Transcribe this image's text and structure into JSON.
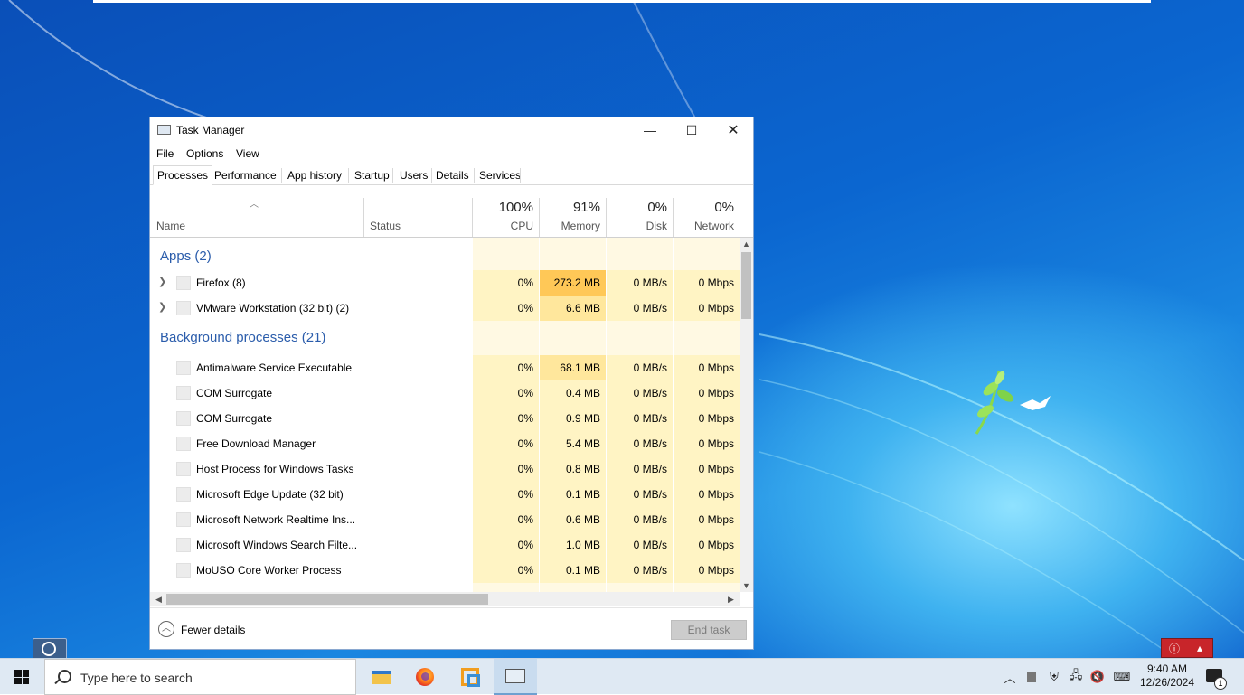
{
  "window": {
    "title": "Task Manager",
    "menu": [
      "File",
      "Options",
      "View"
    ],
    "tabs": [
      "Processes",
      "Performance",
      "App history",
      "Startup",
      "Users",
      "Details",
      "Services"
    ],
    "active_tab": "Processes"
  },
  "columns": {
    "name": "Name",
    "status": "Status",
    "cpu": {
      "percent": "100%",
      "label": "CPU"
    },
    "memory": {
      "percent": "91%",
      "label": "Memory"
    },
    "disk": {
      "percent": "0%",
      "label": "Disk"
    },
    "network": {
      "percent": "0%",
      "label": "Network"
    }
  },
  "groups": {
    "apps": "Apps (2)",
    "background": "Background processes (21)"
  },
  "apps": [
    {
      "name": "Firefox (8)",
      "cpu": "0%",
      "memory": "273.2 MB",
      "disk": "0 MB/s",
      "network": "0 Mbps"
    },
    {
      "name": "VMware Workstation (32 bit) (2)",
      "cpu": "0%",
      "memory": "6.6 MB",
      "disk": "0 MB/s",
      "network": "0 Mbps"
    }
  ],
  "background": [
    {
      "name": "Antimalware Service Executable",
      "cpu": "0%",
      "memory": "68.1 MB",
      "disk": "0 MB/s",
      "network": "0 Mbps"
    },
    {
      "name": "COM Surrogate",
      "cpu": "0%",
      "memory": "0.4 MB",
      "disk": "0 MB/s",
      "network": "0 Mbps"
    },
    {
      "name": "COM Surrogate",
      "cpu": "0%",
      "memory": "0.9 MB",
      "disk": "0 MB/s",
      "network": "0 Mbps"
    },
    {
      "name": "Free Download Manager",
      "cpu": "0%",
      "memory": "5.4 MB",
      "disk": "0 MB/s",
      "network": "0 Mbps"
    },
    {
      "name": "Host Process for Windows Tasks",
      "cpu": "0%",
      "memory": "0.8 MB",
      "disk": "0 MB/s",
      "network": "0 Mbps"
    },
    {
      "name": "Microsoft Edge Update (32 bit)",
      "cpu": "0%",
      "memory": "0.1 MB",
      "disk": "0 MB/s",
      "network": "0 Mbps"
    },
    {
      "name": "Microsoft Network Realtime Ins...",
      "cpu": "0%",
      "memory": "0.6 MB",
      "disk": "0 MB/s",
      "network": "0 Mbps"
    },
    {
      "name": "Microsoft Windows Search Filte...",
      "cpu": "0%",
      "memory": "1.0 MB",
      "disk": "0 MB/s",
      "network": "0 Mbps"
    },
    {
      "name": "MoUSO Core Worker Process",
      "cpu": "0%",
      "memory": "0.1 MB",
      "disk": "0 MB/s",
      "network": "0 Mbps"
    }
  ],
  "footer": {
    "fewer_details": "Fewer details",
    "end_task": "End task"
  },
  "taskbar": {
    "search_placeholder": "Type here to search",
    "time": "9:40 AM",
    "date": "12/26/2024",
    "notification_count": "1",
    "apps": [
      "file-explorer-icon",
      "firefox-icon",
      "vmware-icon",
      "task-manager-icon"
    ]
  },
  "colors": {
    "heat_low": "#fff4c4",
    "heat_mid": "#ffe79c",
    "heat_high": "#ffc857",
    "group_heading": "#2a5cab"
  }
}
